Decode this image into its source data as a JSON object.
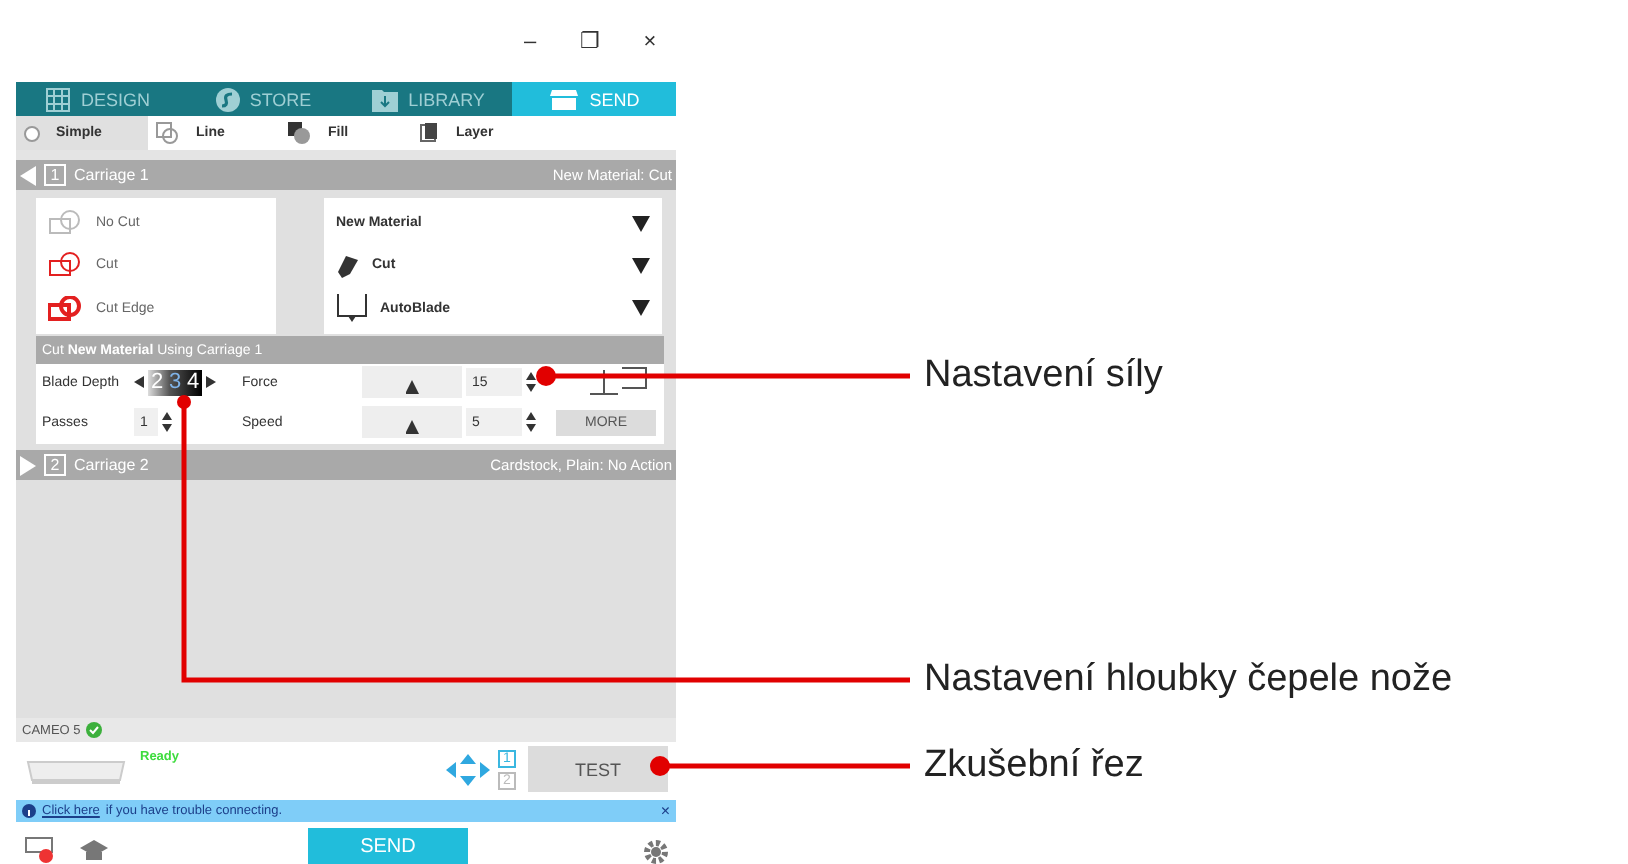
{
  "window": {
    "controls": [
      "–",
      "❐",
      "×"
    ]
  },
  "tabs": [
    {
      "label": "DESIGN",
      "selected": false
    },
    {
      "label": "STORE",
      "selected": false
    },
    {
      "label": "LIBRARY",
      "selected": false
    },
    {
      "label": "SEND",
      "selected": true
    }
  ],
  "modes": [
    {
      "label": "Simple",
      "selected": true
    },
    {
      "label": "Line",
      "selected": false
    },
    {
      "label": "Fill",
      "selected": false
    },
    {
      "label": "Layer",
      "selected": false
    }
  ],
  "carriage1": {
    "number": "1",
    "label": "Carriage 1",
    "summary": "New Material: Cut",
    "expanded": true
  },
  "cut_options": [
    {
      "label": "No Cut",
      "kind": "none"
    },
    {
      "label": "Cut",
      "kind": "cut"
    },
    {
      "label": "Cut Edge",
      "kind": "edge"
    }
  ],
  "material": {
    "value": "New Material"
  },
  "action": {
    "value": "Cut"
  },
  "tool": {
    "value": "AutoBlade"
  },
  "settings_header": "Cut **New Material** Using Carriage 1",
  "blade_depth": {
    "label": "Blade Depth",
    "digits": [
      {
        "text": "2",
        "selected": false
      },
      {
        "text": "3",
        "selected": true
      },
      {
        "text": "4",
        "selected": false
      }
    ]
  },
  "passes": {
    "label": "Passes",
    "value": "1"
  },
  "force": {
    "label": "Force",
    "level": 0.5,
    "value": "15"
  },
  "speed": {
    "label": "Speed",
    "level": 0.5,
    "value": "5"
  },
  "more_button": "MORE",
  "carriage2": {
    "number": "2",
    "label": "Carriage 2",
    "summary": "Cardstock, Plain: No Action",
    "expanded": false
  },
  "device": {
    "name": "CAMEO 5",
    "status": "Ready",
    "connected": true
  },
  "carriage_toggle": [
    {
      "text": "1",
      "selected": true
    },
    {
      "text": "2",
      "selected": false
    }
  ],
  "test_button": "TEST",
  "info_bar": {
    "link": "Click here",
    "text": "if you have trouble connecting.",
    "close": "×"
  },
  "send_button": "SEND",
  "annotations": [
    {
      "text": "Nastavení síly"
    },
    {
      "text": "Nastavení hloubky čepele nože"
    },
    {
      "text": "Zkušební řez"
    }
  ]
}
